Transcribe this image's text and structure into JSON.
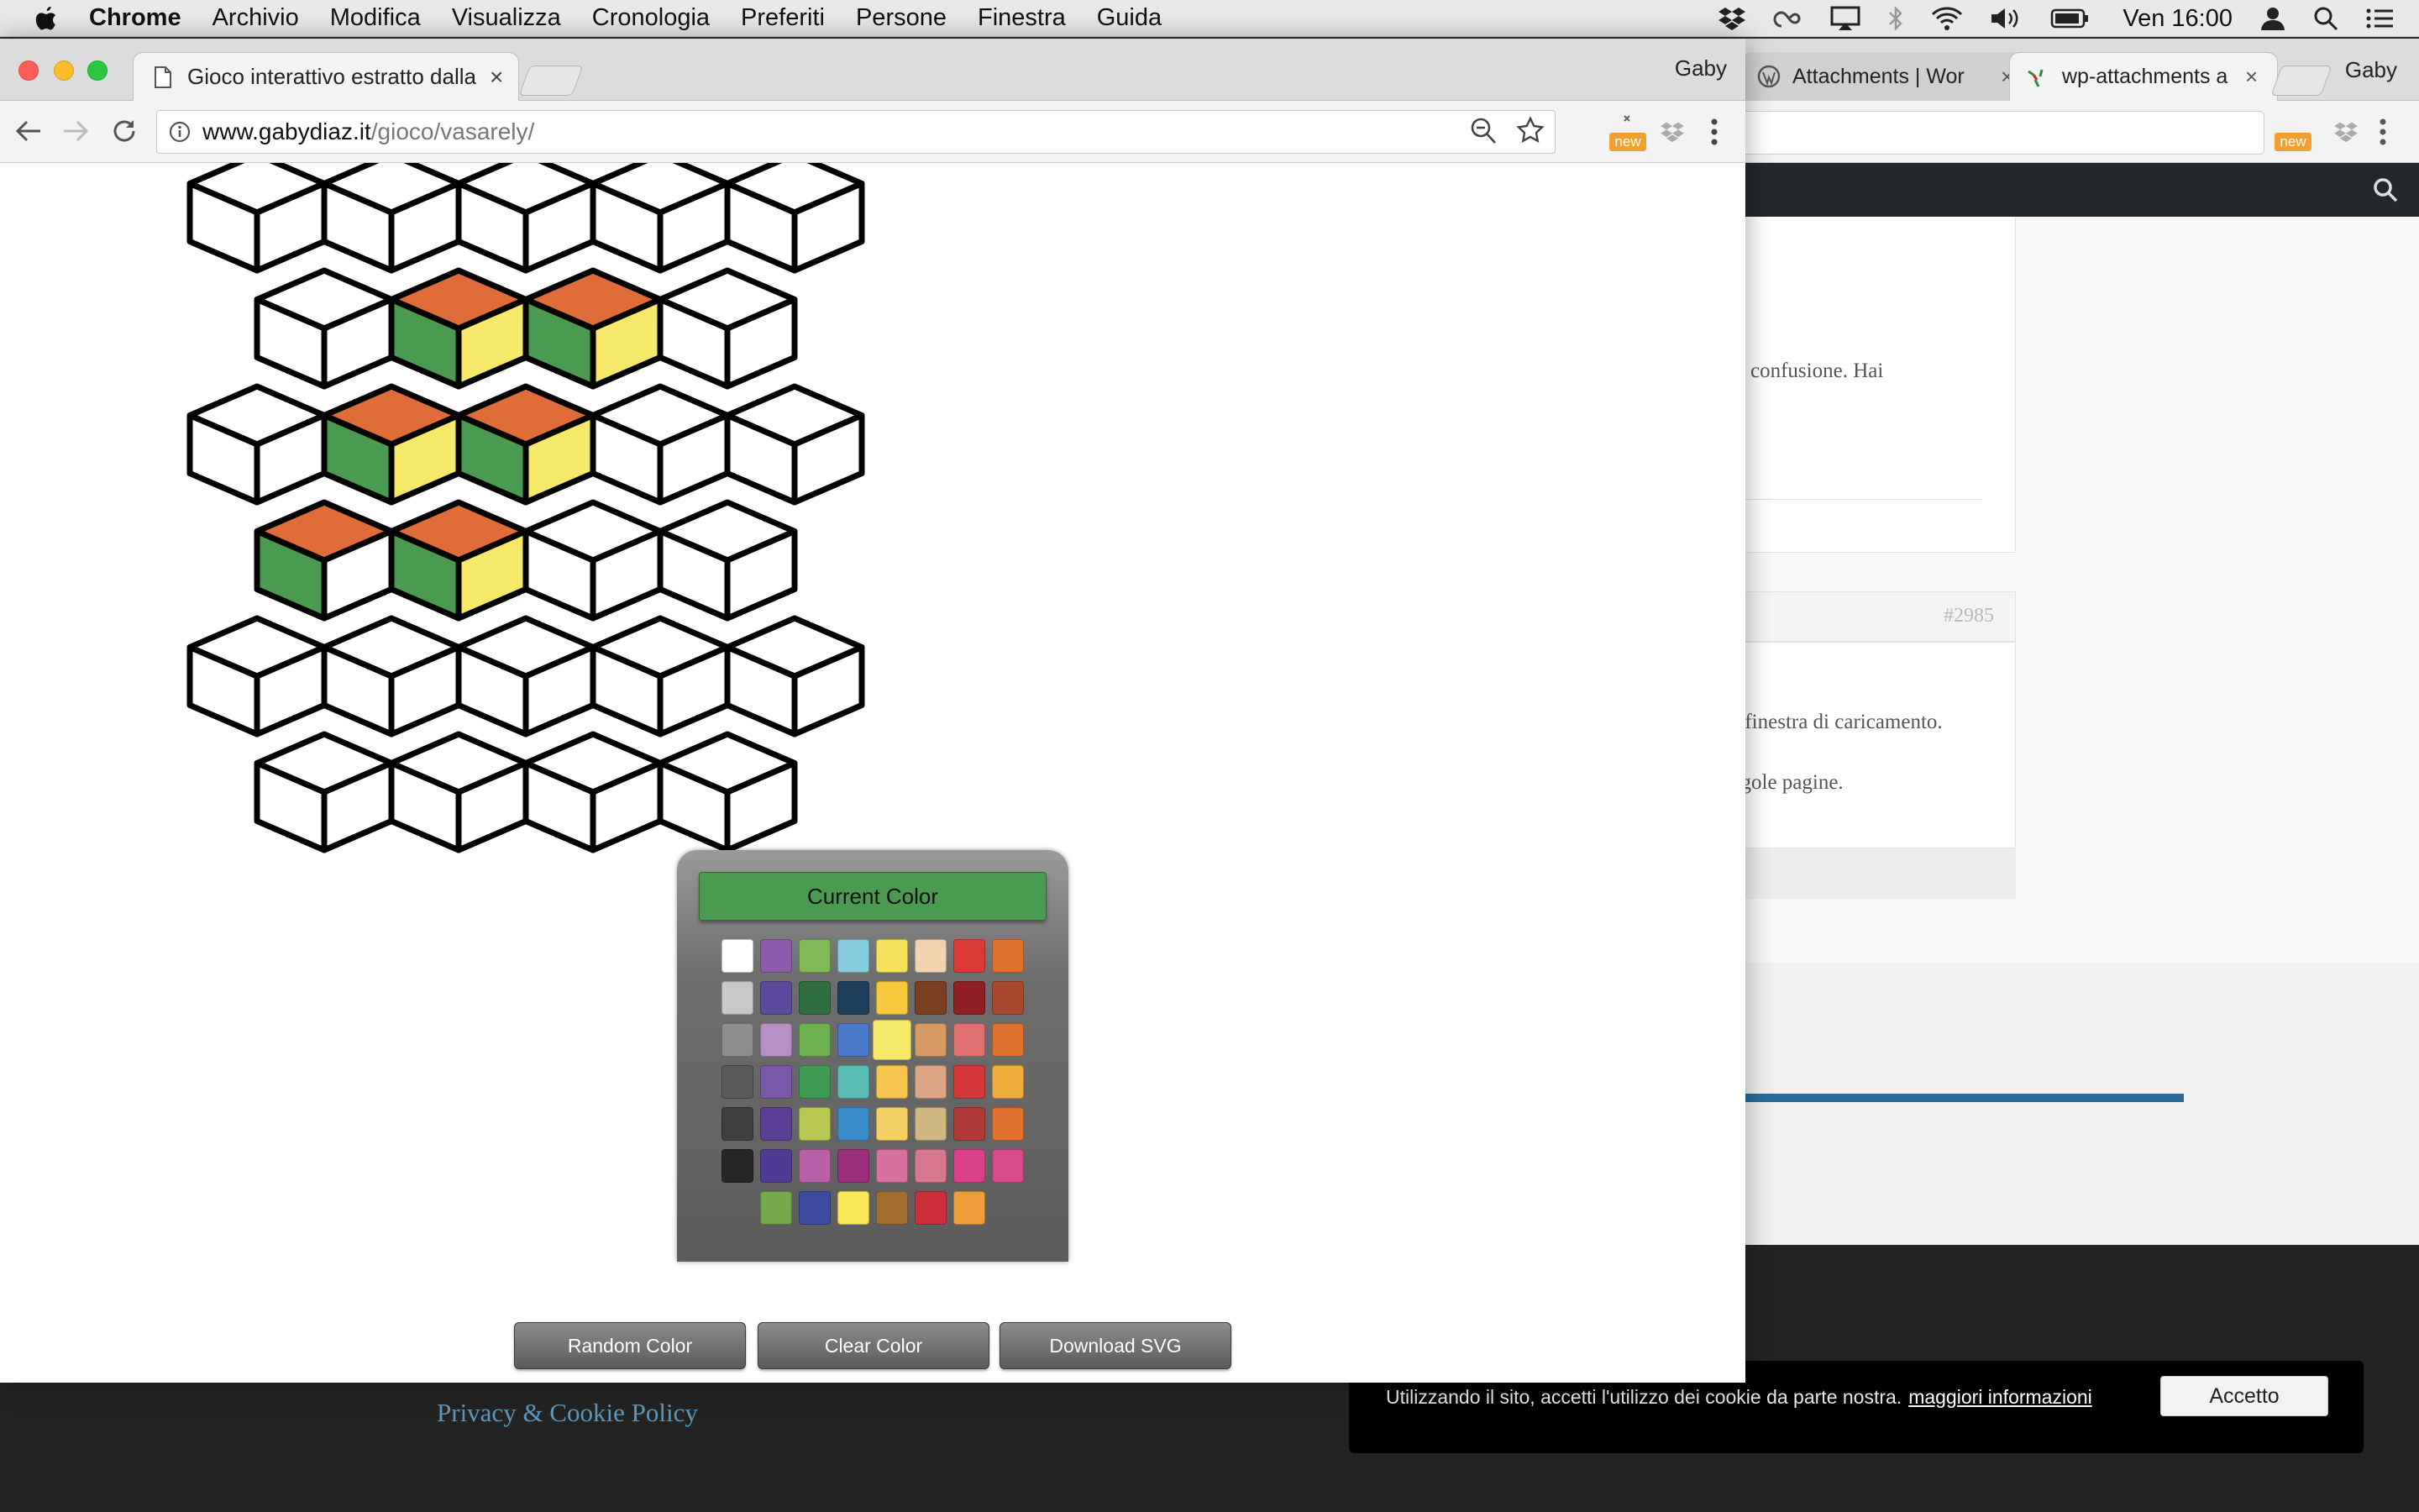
{
  "menubar": {
    "app": "Chrome",
    "items": [
      "Archivio",
      "Modifica",
      "Visualizza",
      "Cronologia",
      "Preferiti",
      "Persone",
      "Finestra",
      "Guida"
    ],
    "clock": "Ven 16:00"
  },
  "browser": {
    "tab_title": "Gioco interattivo estratto dalla",
    "profile": "Gaby",
    "url_host": "www.gabydiaz.it",
    "url_path": "/gioco/vasarely/",
    "extension_badge": "new"
  },
  "background_window": {
    "tabs": [
      "Attachments | Wor",
      "wp-attachments a"
    ],
    "profile": "Gaby",
    "extension_badge": "new",
    "snippets": [
      "confusione. Hai",
      "#2985",
      "a finestra di caricamento.",
      "ngole pagine."
    ],
    "privacy_link": "Privacy & Cookie Policy",
    "cookie": {
      "text": "Utilizzando il sito, accetti l'utilizzo dei cookie da parte nostra.",
      "link": "maggiori informazioni",
      "button": "Accetto"
    }
  },
  "palette": {
    "title": "Current Color",
    "current": "#4a9a50",
    "swatch_rows": [
      [
        "#ffffff",
        "#8b5aa8",
        "#7fba56",
        "#86cde0",
        "#f6e05a",
        "#f3d2b0",
        "#d93a36",
        "#e0702e"
      ],
      [
        "#c8c8c8",
        "#5b4a9e",
        "#2e6e40",
        "#1c3f5c",
        "#f6c83c",
        "#7a3f20",
        "#8e1e22",
        "#a8482e"
      ],
      [
        "#8e8e8e",
        "#b890c8",
        "#6cb050",
        "#4a78c8",
        "#f6e868",
        "#d89a64",
        "#e07070",
        "#e0702e"
      ],
      [
        "#5a5a5a",
        "#7a5aa8",
        "#3e9a50",
        "#58bcb4",
        "#f4c44c",
        "#dca684",
        "#d6383a",
        "#f0ae3c"
      ],
      [
        "#3e3e3e",
        "#5a3e94",
        "#b8c850",
        "#3a8cc8",
        "#f4d064",
        "#d0b680",
        "#b03a38",
        "#e0702e"
      ],
      [
        "#262626",
        "#4e3a92",
        "#b860a8",
        "#9a2e7a",
        "#d870a0",
        "#d87890",
        "#d8408a",
        "#d84c8c"
      ],
      [
        "#74a84c",
        "#3c4aa0",
        "#f8e858",
        "#a06c30",
        "#cc2e3a",
        "#f09e3a"
      ]
    ]
  },
  "buttons": {
    "random": "Random Color",
    "clear": "Clear Color",
    "download": "Download SVG"
  },
  "tiling": {
    "colors": {
      "O": "#e06c3a",
      "Y": "#f6e868",
      "G": "#4a9a50",
      "W": "#ffffff"
    },
    "cubes": [
      [
        "WWW",
        "WWW",
        "WWW",
        "WWW",
        "WWW"
      ],
      [
        "WWW",
        "OGY",
        "OGY",
        "WWW"
      ],
      [
        "WWW",
        "OGY",
        "OGY",
        "WWW",
        "WWW"
      ],
      [
        "OGW",
        "OGY",
        "WWW",
        "WWW"
      ],
      [
        "WWW",
        "WWW",
        "WWW",
        "WWW",
        "WWW"
      ],
      [
        "WWW",
        "WWW",
        "WWW",
        "WWW"
      ]
    ]
  }
}
